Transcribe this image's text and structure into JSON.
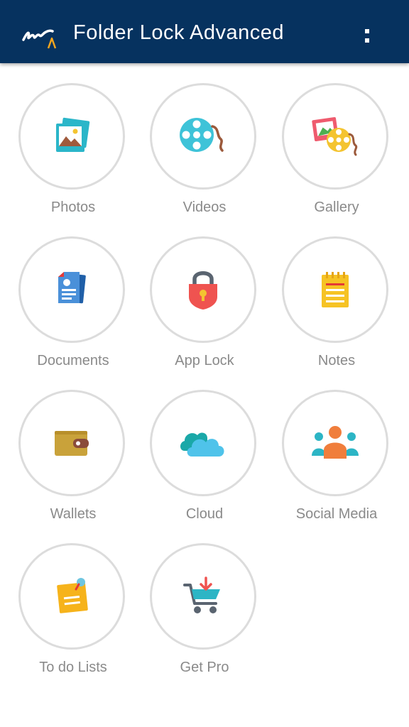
{
  "app_bar": {
    "title": "Folder Lock Advanced",
    "logo_icon": "signature-logo-icon",
    "menu_icon": "more-vert-icon",
    "background_color": "#06325f"
  },
  "tiles": [
    {
      "label": "Photos",
      "icon": "photos-icon"
    },
    {
      "label": "Videos",
      "icon": "video-reel-icon"
    },
    {
      "label": "Gallery",
      "icon": "gallery-icon"
    },
    {
      "label": "Documents",
      "icon": "documents-icon"
    },
    {
      "label": "App Lock",
      "icon": "padlock-icon"
    },
    {
      "label": "Notes",
      "icon": "notepad-icon"
    },
    {
      "label": "Wallets",
      "icon": "wallet-icon"
    },
    {
      "label": "Cloud",
      "icon": "cloud-icon"
    },
    {
      "label": "Social Media",
      "icon": "people-group-icon"
    },
    {
      "label": "To do Lists",
      "icon": "sticky-note-icon"
    },
    {
      "label": "Get Pro",
      "icon": "shopping-cart-icon"
    }
  ]
}
